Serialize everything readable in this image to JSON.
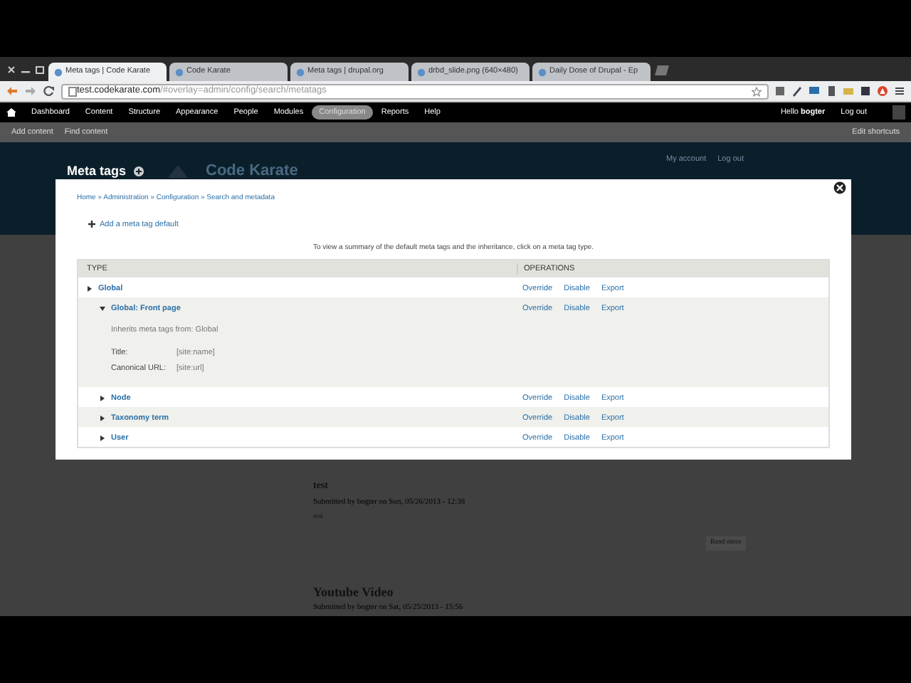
{
  "browser": {
    "tabs": [
      {
        "label": "Meta tags | Code Karate",
        "selected": true
      },
      {
        "label": "Code Karate",
        "selected": false
      },
      {
        "label": "Meta tags | drupal.org",
        "selected": false
      },
      {
        "label": "drbd_slide.png (640×480)",
        "selected": false
      },
      {
        "label": "Daily Dose of Drupal - Ep",
        "selected": false
      }
    ],
    "address": {
      "host": "test.codekarate.com",
      "path": "/#overlay=admin/config/search/metatags"
    }
  },
  "toolbar": {
    "items": [
      {
        "label": "Dashboard",
        "selected": false
      },
      {
        "label": "Content",
        "selected": false
      },
      {
        "label": "Structure",
        "selected": false
      },
      {
        "label": "Appearance",
        "selected": false
      },
      {
        "label": "People",
        "selected": false
      },
      {
        "label": "Modules",
        "selected": false
      },
      {
        "label": "Configuration",
        "selected": true
      },
      {
        "label": "Reports",
        "selected": false
      },
      {
        "label": "Help",
        "selected": false
      }
    ],
    "greeting": "Hello **bogter**",
    "logout": "Log out"
  },
  "shortcuts": {
    "items": [
      "Add content",
      "Find content"
    ],
    "edit": "Edit shortcuts"
  },
  "page_header": {
    "title": "Meta tags",
    "site_name": "Code Karate",
    "links": [
      "My account",
      "Log out"
    ]
  },
  "dialog": {
    "breadcrumb": "Home » Administration » Configuration » Search and metadata",
    "add_link": "Add a meta tag default",
    "summary": "To view a summary of the default meta tags and the inheritance, click on a meta tag type.",
    "table": {
      "columns": [
        "TYPE",
        "OPERATIONS"
      ],
      "rows": [
        {
          "name": "Global",
          "expanded": false,
          "operations": [
            "Override",
            "Disable",
            "Export"
          ],
          "children": [
            {
              "name": "Global: Front page",
              "expanded": true,
              "note": "Inherits meta tags from: Global",
              "details": [
                {
                  "label": "Title:",
                  "value": "[site:name]"
                },
                {
                  "label": "Canonical URL:",
                  "value": "[site:url]"
                }
              ],
              "operations": [
                "Override",
                "Disable",
                "Export"
              ]
            },
            {
              "name": "Node",
              "expanded": false,
              "operations": [
                "Override",
                "Disable",
                "Export"
              ]
            },
            {
              "name": "Taxonomy term",
              "expanded": false,
              "operations": [
                "Override",
                "Disable",
                "Export"
              ]
            },
            {
              "name": "User",
              "expanded": false,
              "operations": [
                "Override",
                "Disable",
                "Export"
              ]
            }
          ]
        }
      ]
    }
  },
  "posts": [
    {
      "title": "test",
      "submitted": "Submitted by bogter on Sun, 05/26/2013 - 12:38",
      "body": "test",
      "more": "Read more"
    },
    {
      "title": "Youtube Video",
      "submitted": "Submitted by bogter on Sat, 05/25/2013 - 15:56"
    }
  ]
}
